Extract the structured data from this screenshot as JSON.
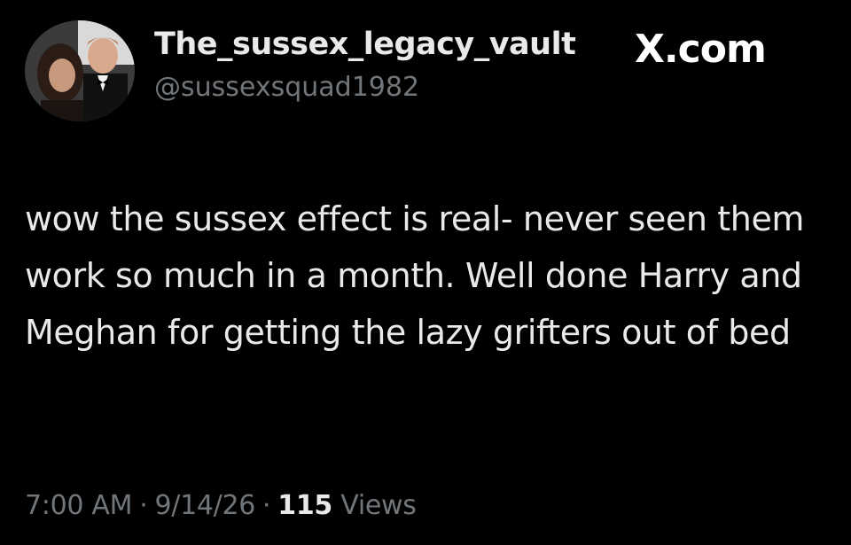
{
  "tweet": {
    "display_name": "The_sussex_legacy_vault",
    "handle": "@sussexsquad1982",
    "brand": "X.com",
    "text": "wow the sussex effect is real- never seen them work so much in a month. Well done Harry and Meghan for getting the lazy grifters out of bed",
    "time": "7:00 AM",
    "date": "9/14/26",
    "views_count": "115",
    "views_label": "Views",
    "separator": "·"
  },
  "colors": {
    "background": "#000000",
    "primary_text": "#e7e9ea",
    "secondary_text": "#71767b"
  }
}
